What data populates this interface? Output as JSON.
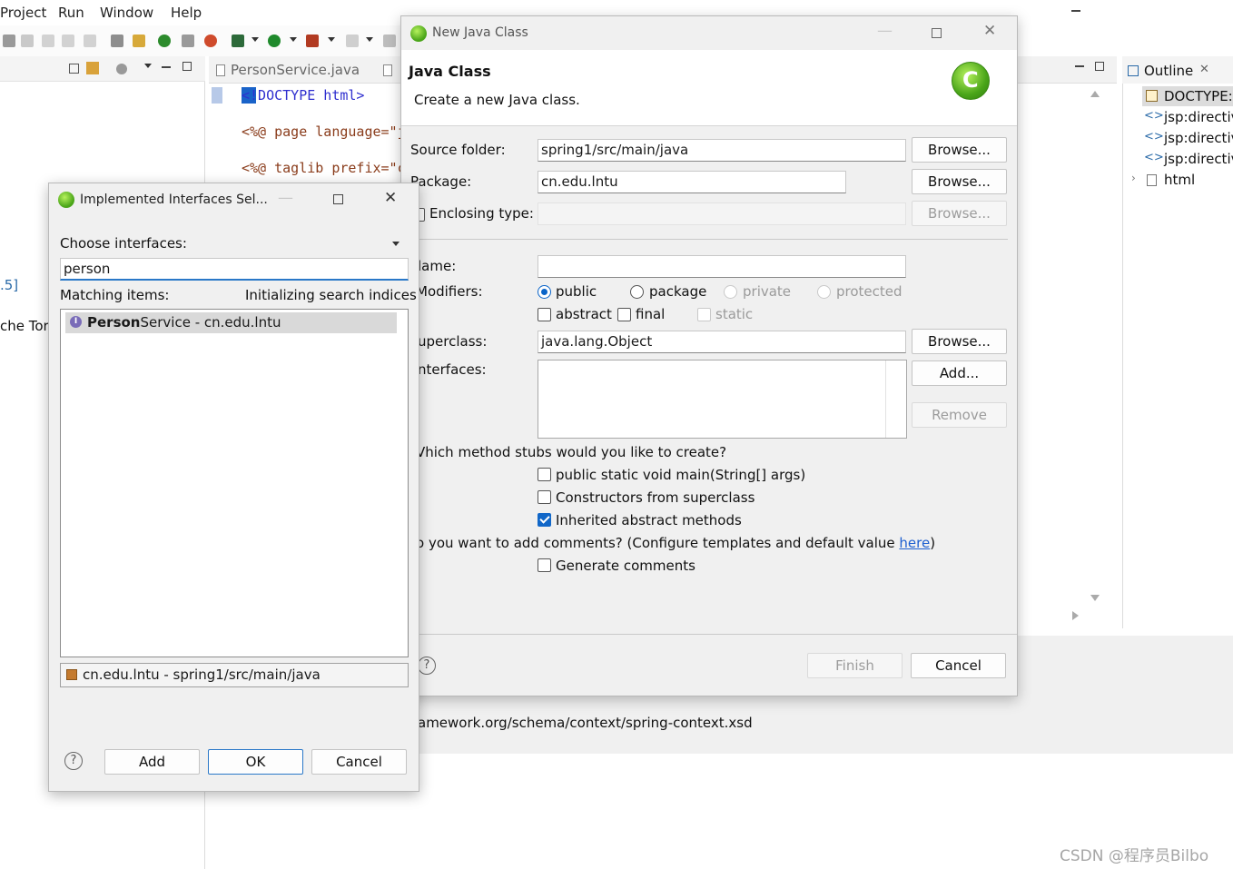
{
  "menubar": {
    "items": [
      "Project",
      "Run",
      "Window",
      "Help"
    ]
  },
  "editor": {
    "tabs": [
      "PersonService.java"
    ],
    "code_lines": [
      "<!DOCTYPE html>",
      "<%@ page language=\"j",
      "<%@ taglib prefix=\"c"
    ]
  },
  "left_panel": {
    "fragment_1": ".5]",
    "fragment_2": "che Tor"
  },
  "outline": {
    "title": "Outline",
    "items": [
      "DOCTYPE:h",
      "jsp:directiv",
      "jsp:directiv",
      "jsp:directiv",
      "html"
    ]
  },
  "bottom": {
    "text": "amework.org/schema/context/spring-context.xsd"
  },
  "watermark": "CSDN @程序员Bilbo",
  "new_java_class": {
    "window_title": "New Java Class",
    "heading": "Java Class",
    "subheading": "Create a new Java class.",
    "source_folder": {
      "label": "Source folder:",
      "value": "spring1/src/main/java",
      "button": "Browse..."
    },
    "package": {
      "label": "Package:",
      "value": "cn.edu.lntu",
      "button": "Browse..."
    },
    "enclosing_type": {
      "label": "Enclosing type:",
      "value": "",
      "button": "Browse...",
      "checked": false
    },
    "name": {
      "label": "lame:",
      "value": ""
    },
    "modifiers": {
      "label": "Modifiers:",
      "access": [
        "public",
        "package",
        "private",
        "protected"
      ],
      "selected": "public",
      "flags": [
        "abstract",
        "final",
        "static"
      ]
    },
    "superclass": {
      "label": "uperclass:",
      "value": "java.lang.Object",
      "button": "Browse..."
    },
    "interfaces": {
      "label": "nterfaces:",
      "add_button": "Add...",
      "remove_button": "Remove"
    },
    "stubs": {
      "question": "Vhich method stubs would you like to create?",
      "options": [
        {
          "label": "public static void main(String[] args)",
          "checked": false
        },
        {
          "label": "Constructors from superclass",
          "checked": false
        },
        {
          "label": "Inherited abstract methods",
          "checked": true
        }
      ]
    },
    "comments": {
      "question_prefix": "o you want to add comments? (Configure templates and default value ",
      "link": "here",
      "question_suffix": ")",
      "option": "Generate comments",
      "checked": false
    },
    "finish_button": "Finish",
    "cancel_button": "Cancel"
  },
  "interfaces_dialog": {
    "window_title": "Implemented Interfaces Sel...",
    "choose_label": "Choose interfaces:",
    "search_value": "person",
    "matching_label": "Matching items:",
    "status": "Initializing search indices",
    "results": [
      {
        "match": "Person",
        "rest": "Service - cn.edu.lntu"
      }
    ],
    "package_info": "cn.edu.lntu - spring1/src/main/java",
    "add_button": "Add",
    "ok_button": "OK",
    "cancel_button": "Cancel"
  },
  "colors": {
    "accent": "#0a64c8",
    "link": "#1d5fd0",
    "selection": "#d9d9d9"
  }
}
